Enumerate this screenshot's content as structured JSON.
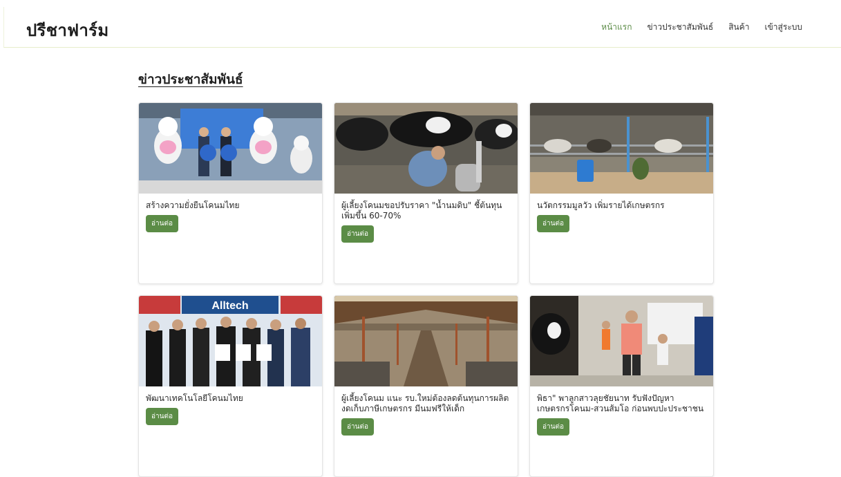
{
  "header": {
    "brand": "ปรีชาฟาร์ม",
    "nav": [
      {
        "label": "หน้าแรก",
        "active": true
      },
      {
        "label": "ข่าวประชาสัมพันธ์",
        "active": false
      },
      {
        "label": "สินค้า",
        "active": false
      },
      {
        "label": "เข้าสู่ระบบ",
        "active": false
      }
    ]
  },
  "main": {
    "section_title": "ข่าวประชาสัมพันธ์",
    "read_more_label": "อ่านต่อ",
    "cards": [
      {
        "title": "สร้างความยั่งยืนโคนมไทย",
        "image": "cow-mascots-event-photo"
      },
      {
        "title": "ผู้เลี้ยงโคนมขอปรับราคา \"น้ำนมดิบ\" ชี้ต้นทุนเพิ่มขึ้น 60-70%",
        "image": "milking-cows-photo"
      },
      {
        "title": "นวัตกรรมมูลวัว เพิ่มรายได้เกษตรกร",
        "image": "cattle-barn-photo"
      },
      {
        "title": "พัฒนาเทคโนโลยีโคนมไทย",
        "image": "alltech-signing-photo"
      },
      {
        "title": "ผู้เลี้ยงโคนม แนะ รบ.ใหม่ต้องลดต้นทุนการผลิต งดเก็บภาษีเกษตรกร มีนมฟรีให้เด็ก",
        "image": "empty-barn-photo"
      },
      {
        "title": "พิธา\" พาลูกสาวลุยชัยนาท รับฟังปัญหาเกษตรกรโคนม-สวนส้มโอ ก่อนพบปะประชาชน",
        "image": "farm-visit-photo"
      }
    ]
  },
  "colors": {
    "accent": "#5b8c46",
    "nav_active": "#5c8c47"
  }
}
